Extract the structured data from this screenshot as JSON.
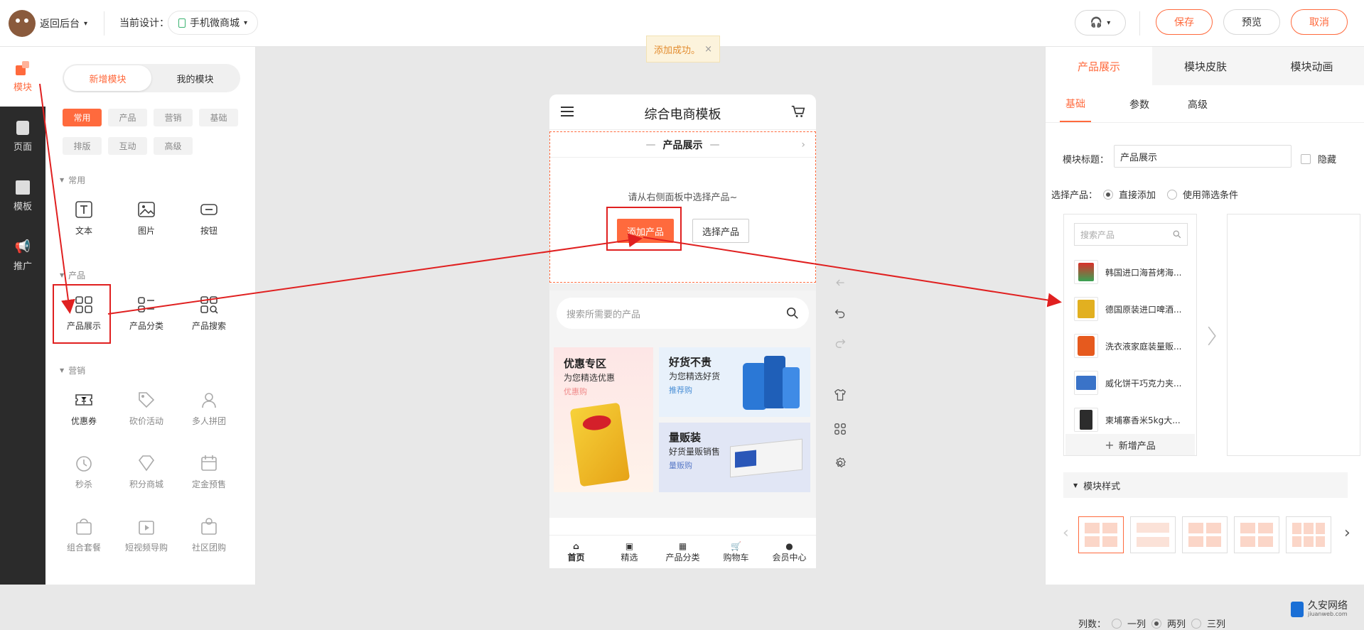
{
  "topbar": {
    "back_label": "返回后台",
    "current_design_label": "当前设计：",
    "design_name": "手机微商城",
    "save_label": "保存",
    "preview_label": "预览",
    "cancel_label": "取消"
  },
  "toast": {
    "text": "添加成功。",
    "close": "×"
  },
  "rail": {
    "items": [
      {
        "label": "模块",
        "icon": "module-icon"
      },
      {
        "label": "页面",
        "icon": "page-icon"
      },
      {
        "label": "模板",
        "icon": "template-icon"
      },
      {
        "label": "推广",
        "icon": "promote-icon"
      }
    ]
  },
  "modules": {
    "tabs": [
      "新增模块",
      "我的模块"
    ],
    "categories": [
      "常用",
      "产品",
      "营销",
      "基础",
      "排版",
      "互动",
      "高级"
    ],
    "sections": [
      {
        "title": "常用",
        "items": [
          "文本",
          "图片",
          "按钮"
        ]
      },
      {
        "title": "产品",
        "items": [
          "产品展示",
          "产品分类",
          "产品搜索"
        ]
      },
      {
        "title": "营销",
        "items": [
          "优惠券",
          "砍价活动",
          "多人拼团",
          "秒杀",
          "积分商城",
          "定金预售",
          "组合套餐",
          "短视频导购",
          "社区团购"
        ]
      }
    ]
  },
  "phone": {
    "title": "综合电商模板",
    "section_title": "产品展示",
    "hint": "请从右侧面板中选择产品~",
    "add_button": "添加产品",
    "select_button": "选择产品",
    "search_placeholder": "搜索所需要的产品",
    "promos": [
      {
        "title": "优惠专区",
        "sub": "为您精选优惠",
        "tag": "优惠购"
      },
      {
        "title": "好货不贵",
        "sub": "为您精选好货",
        "tag": "推荐购"
      },
      {
        "title": "量贩装",
        "sub": "好货量贩销售",
        "tag": "量贩购"
      }
    ],
    "nav": [
      "首页",
      "精选",
      "产品分类",
      "购物车",
      "会员中心"
    ]
  },
  "rpanel": {
    "tabs": [
      "产品展示",
      "模块皮肤",
      "模块动画"
    ],
    "subtabs": [
      "基础",
      "参数",
      "高级"
    ],
    "title_label": "模块标题：",
    "title_value": "产品展示",
    "hide_label": "隐藏",
    "select_label": "选择产品：",
    "opt_direct": "直接添加",
    "opt_filter": "使用筛选条件",
    "search_placeholder": "搜索产品",
    "products": [
      "韩国进口海苔烤海...",
      "德国原装进口啤酒...",
      "洗衣液家庭装量贩...",
      "威化饼干巧克力夹...",
      "柬埔寨香米5kg大..."
    ],
    "add_product": "新增产品",
    "style_section": "模块样式",
    "columns_label": "列数：",
    "col_one": "一列",
    "col_two": "两列",
    "col_three": "三列"
  },
  "watermark": {
    "name": "久安网络",
    "url": "jiuanweb.com"
  },
  "colors": {
    "accent": "#ff6a3d",
    "annotation": "#e02020"
  }
}
